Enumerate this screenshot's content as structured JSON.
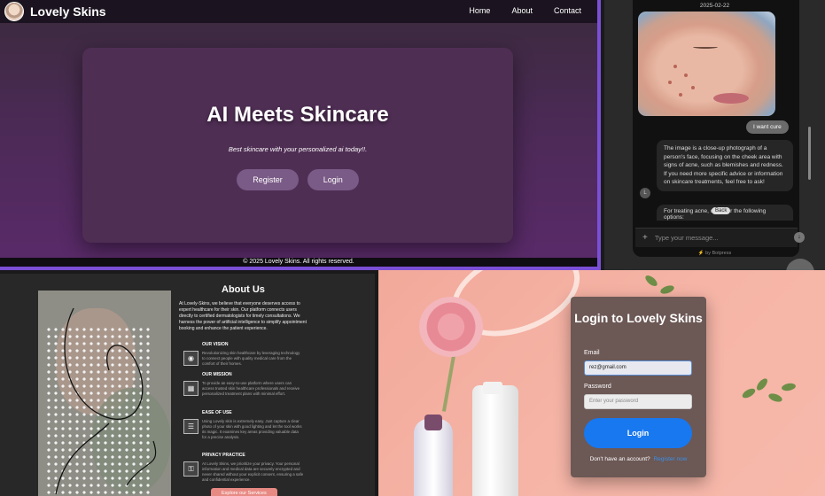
{
  "landing": {
    "brand": "Lovely Skins",
    "nav": [
      "Home",
      "About",
      "Contact"
    ],
    "hero_title": "AI Meets Skincare",
    "tagline": "Best skincare with your personalized ai today!!.",
    "register_label": "Register",
    "login_label": "Login",
    "footer": "© 2025 Lovely Skins. All rights reserved.",
    "accent": "#7b4fd6"
  },
  "chat": {
    "date": "2025-02-22",
    "user_message": "I want cure",
    "bot_message": "The image is a close-up photograph of a person's face, focusing on the cheek area with signs of acne, such as blemishes and redness. If you need more specific advice or information on skincare treatments, feel free to ask!",
    "avatar_letter": "L",
    "bot_message_2": "For treating acne, consider the following options:",
    "back_label": "Back",
    "input_placeholder": "Type your message...",
    "powered_by": "⚡ by Botpress"
  },
  "about": {
    "title": "About Us",
    "intro": "At Lovely-Skins, we believe that everyone deserves access to expert healthcare for their skin. Our platform connects users directly to certified dermatologists for timely consultations. We harness the power of artificial intelligence to simplify appointment booking and enhance the patient experience.",
    "sections": [
      {
        "heading": "OUR VISION",
        "body": "Revolutionizing skin healthcare by leveraging technology to connect people with quality medical care from the comfort of their homes.",
        "icon": "vision-icon"
      },
      {
        "heading": "OUR MISSION",
        "body": "To provide an easy-to-use platform where users can access trusted skin healthcare professionals and receive personalized treatment plans with minimal effort.",
        "icon": "mission-icon"
      },
      {
        "heading": "EASE OF USE",
        "body": "Using Lovely skin is extremely easy. Just capture a clear photo of your skin with good lighting and let the tool works its magic. It examines key areas providing valuable data for a precise analysis.",
        "icon": "ease-icon"
      },
      {
        "heading": "PRIVACY PRACTICE",
        "body": "At Lovely Skins, we prioritize your privacy. Your personal information and medical data are securely encrypted and never shared without your explicit consent, ensuring a safe and confidential experience.",
        "icon": "privacy-icon"
      }
    ],
    "explore_label": "Explore our Services"
  },
  "login": {
    "title": "Login to Lovely Skins",
    "email_label": "Email",
    "email_value": "rez@gmail.com",
    "password_label": "Password",
    "password_placeholder": "Enter your password",
    "button": "Login",
    "signup_text": "Don't have an account?",
    "signup_link": "Register now"
  }
}
